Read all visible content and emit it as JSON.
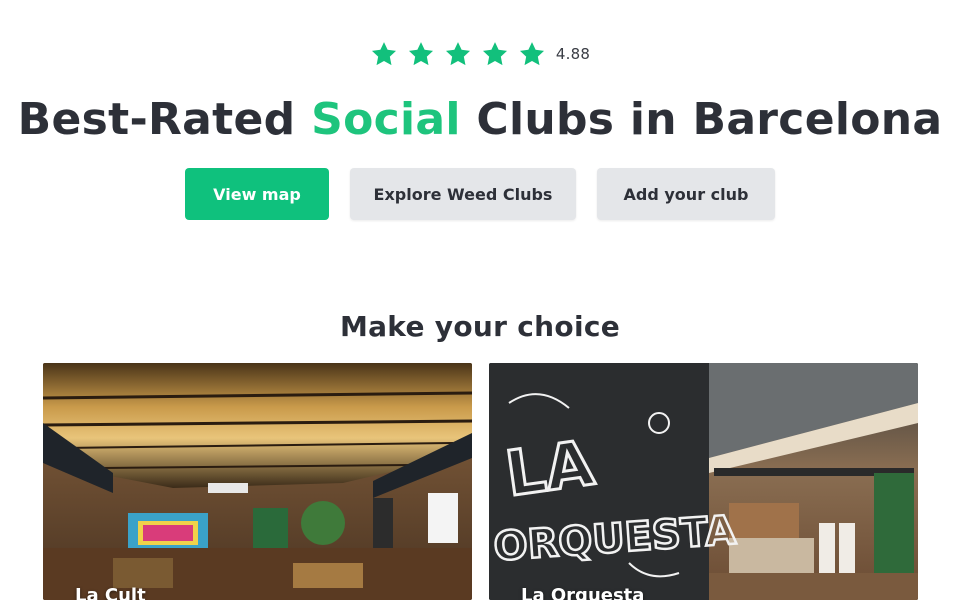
{
  "rating": {
    "star_count": 5,
    "star_icon": "star-icon",
    "value": "4.88",
    "color": "#12c07c"
  },
  "headline": {
    "before": "Best-Rated ",
    "accent": "Social",
    "after": " Clubs in Barcelona",
    "accent_color": "#1ec47d"
  },
  "actions": {
    "view_map": "View map",
    "explore": "Explore Weed Clubs",
    "add_club": "Add your club",
    "primary_color": "#0fc17d",
    "secondary_color": "#e4e6e9"
  },
  "choices": {
    "title": "Make your choice",
    "cards": [
      {
        "name": "La Cult",
        "photo": "club-interior-photo"
      },
      {
        "name": "La Orquesta",
        "photo": "la-orquesta-interior-photo",
        "mural_text": "LA ORQUESTA"
      }
    ]
  }
}
